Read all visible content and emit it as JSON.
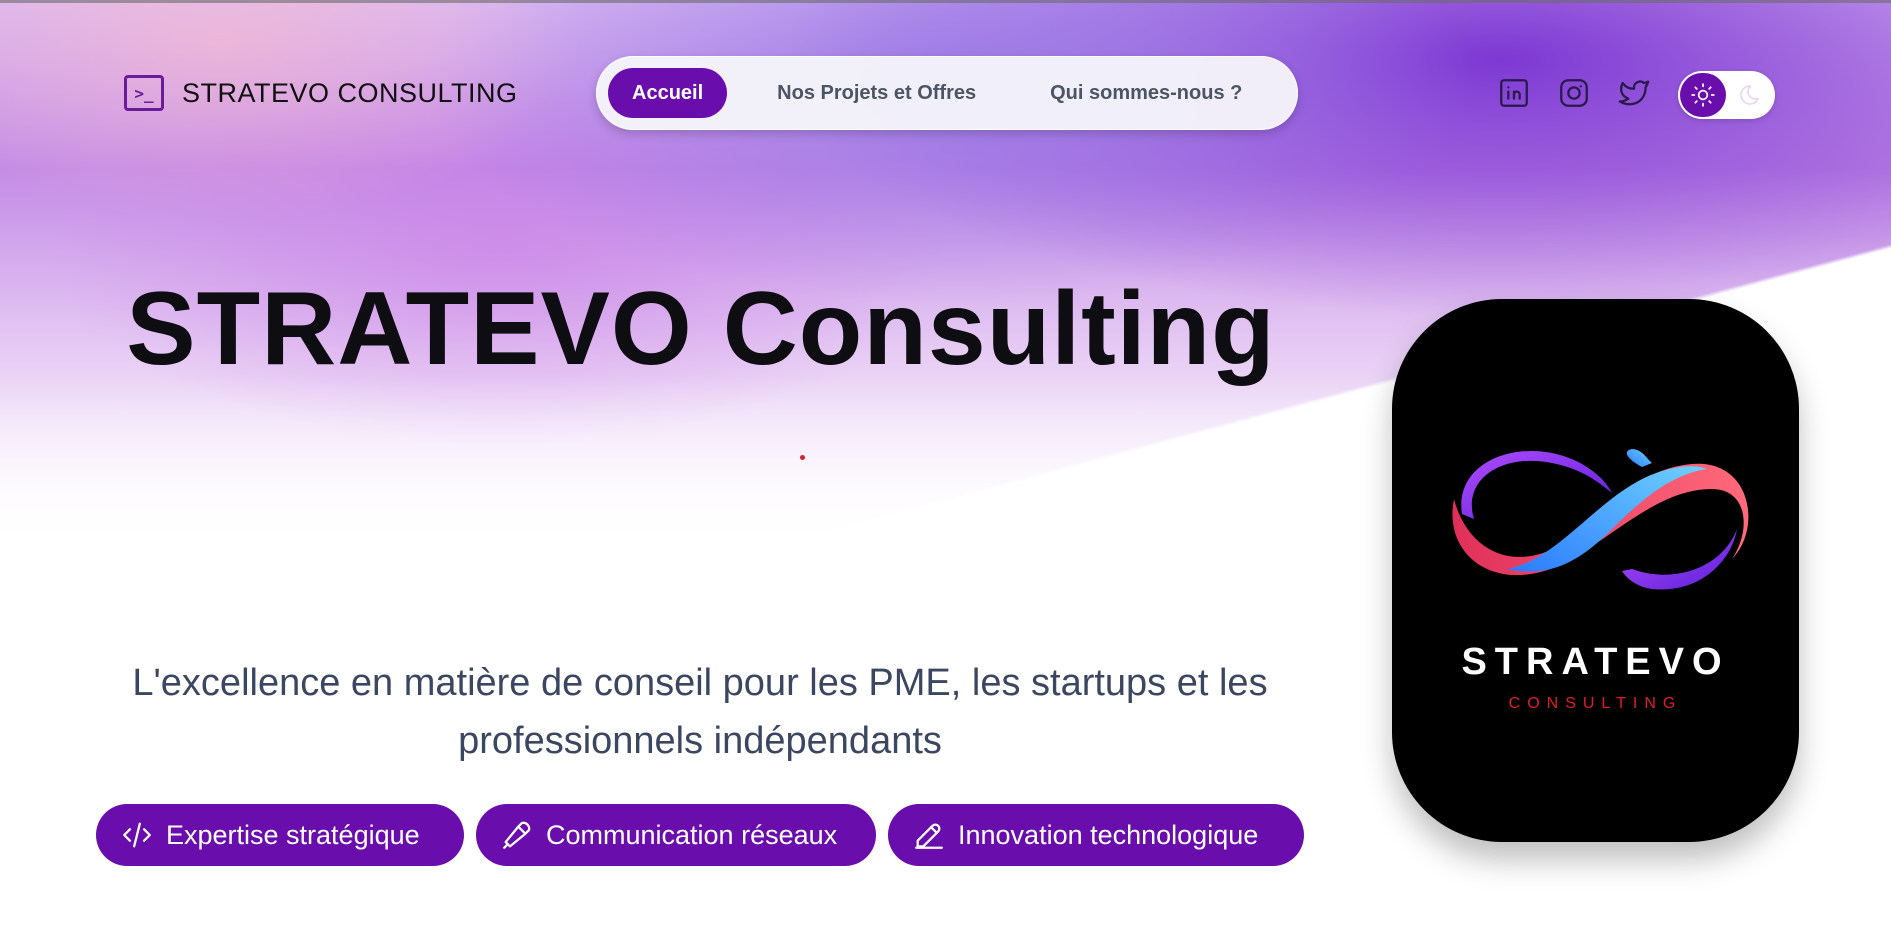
{
  "brand": {
    "icon": "terminal-icon",
    "icon_text": ">_",
    "name": "STRATEVO CONSULTING"
  },
  "nav": {
    "items": [
      {
        "label": "Accueil",
        "active": true
      },
      {
        "label": "Nos Projets et Offres",
        "active": false
      },
      {
        "label": "Qui sommes-nous ?",
        "active": false
      }
    ]
  },
  "socials": [
    {
      "icon": "linkedin-icon"
    },
    {
      "icon": "instagram-icon"
    },
    {
      "icon": "twitter-icon"
    }
  ],
  "theme_toggle": {
    "active": "light",
    "icons": [
      "sun-icon",
      "moon-icon"
    ]
  },
  "hero": {
    "title": "STRATEVO Consulting",
    "subtitle": "L'excellence en matière de conseil pour les PME, les startups et les professionnels indépendants"
  },
  "pills": [
    {
      "icon": "code-icon",
      "label": "Expertise stratégique"
    },
    {
      "icon": "microphone-icon",
      "label": "Communication réseaux"
    },
    {
      "icon": "pencil-icon",
      "label": "Innovation technologique"
    }
  ],
  "logo": {
    "name": "STRATEVO",
    "sub": "CONSULTING"
  },
  "colors": {
    "accent": "#6a0dad",
    "title": "#0d0d12",
    "subtitle": "#3b4660",
    "logo_sub": "#e11d2a"
  }
}
